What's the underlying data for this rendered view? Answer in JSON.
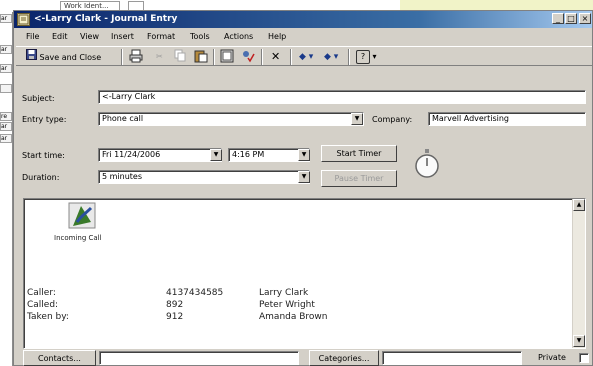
{
  "background": {
    "chip_labels": [
      "Work Ident..."
    ],
    "left_tabs": [
      "ar",
      "ar",
      "ar",
      "",
      "re",
      "ar",
      "ar"
    ]
  },
  "window": {
    "title": "<-Larry Clark - Journal Entry",
    "controls": {
      "minimize": "_",
      "maximize": "□",
      "close": "×"
    }
  },
  "menu": [
    "File",
    "Edit",
    "View",
    "Insert",
    "Format",
    "Tools",
    "Actions",
    "Help"
  ],
  "toolbar": {
    "save_close_label": "Save and Close",
    "icons": [
      "print-icon",
      "cut-icon",
      "copy-icon",
      "paste-icon",
      "address-book-icon",
      "check-names-icon",
      "delete-icon",
      "previous-item-icon",
      "next-item-icon",
      "help-icon"
    ]
  },
  "form": {
    "subject_label": "Subject:",
    "subject_value": "<-Larry Clark",
    "entry_type_label": "Entry type:",
    "entry_type_value": "Phone call",
    "company_label": "Company:",
    "company_value": "Marvell Advertising",
    "start_time_label": "Start time:",
    "start_date_value": "Fri 11/24/2006",
    "start_time_value": "4:16 PM",
    "start_timer_label": "Start Timer",
    "pause_timer_label": "Pause Timer",
    "duration_label": "Duration:",
    "duration_value": "5 minutes"
  },
  "notes": {
    "attachment_label": "Incoming Call",
    "rows": [
      {
        "key": "Caller:",
        "number": "4137434585",
        "name": "Larry Clark"
      },
      {
        "key": "Called:",
        "number": "892",
        "name": "Peter Wright"
      },
      {
        "key": "Taken by:",
        "number": "912",
        "name": "Amanda Brown"
      }
    ]
  },
  "footer": {
    "contacts_label": "Contacts...",
    "contacts_value": "",
    "categories_label": "Categories...",
    "categories_value": "",
    "private_label": "Private"
  },
  "colors": {
    "titlebar_start": "#0a246a",
    "titlebar_end": "#a6caf0",
    "chrome": "#d4d0c8"
  }
}
